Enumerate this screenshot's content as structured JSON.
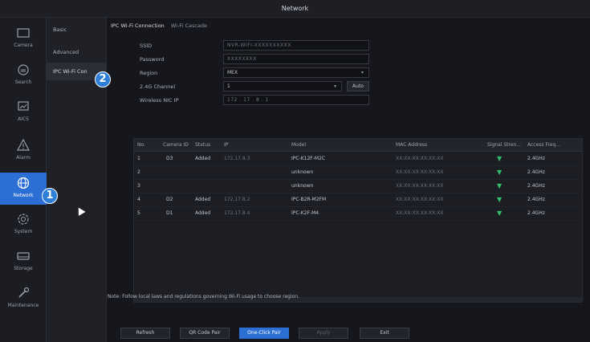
{
  "window": {
    "title": "Network"
  },
  "nav": {
    "items": [
      {
        "id": "camera",
        "label": "Camera",
        "icon": "camera-icon"
      },
      {
        "id": "search",
        "label": "Search",
        "icon": "search-icon"
      },
      {
        "id": "aics",
        "label": "AICS",
        "icon": "ai-icon"
      },
      {
        "id": "alarm",
        "label": "Alarm",
        "icon": "alarm-icon"
      },
      {
        "id": "network",
        "label": "Network",
        "icon": "globe-icon"
      },
      {
        "id": "system",
        "label": "System",
        "icon": "gear-icon"
      },
      {
        "id": "storage",
        "label": "Storage",
        "icon": "storage-icon"
      },
      {
        "id": "maintenance",
        "label": "Maintenance",
        "icon": "wrench-icon"
      }
    ]
  },
  "subnav": {
    "items": [
      {
        "label": "Basic"
      },
      {
        "label": "Advanced"
      },
      {
        "label": "IPC Wi-Fi Con"
      }
    ]
  },
  "tabs": [
    {
      "label": "IPC Wi-Fi Connection"
    },
    {
      "label": "Wi-Fi Cascade"
    }
  ],
  "form": {
    "ssid": {
      "label": "SSID",
      "value": "NVR-WIFI-XXXXXXXXXX"
    },
    "password": {
      "label": "Password",
      "value": "XXXXXXXX"
    },
    "region": {
      "label": "Region",
      "value": "MEX"
    },
    "channel": {
      "label": "2.4G Channel",
      "value": "1",
      "auto_label": "Auto"
    },
    "wireless_ip": {
      "label": "Wireless NIC IP",
      "value": "172 . 17 . 8 . 1"
    }
  },
  "table": {
    "headers": [
      "No.",
      "Camera ID",
      "Status",
      "IP",
      "Model",
      "MAC Address",
      "Signal Stren...",
      "Access Freq..."
    ],
    "rows": [
      {
        "no": "1",
        "camera_id": "D3",
        "status": "Added",
        "ip": "172.17.8.3",
        "model": "IPC-K12F-M2C",
        "mac": "XX:XX:XX:XX:XX:XX",
        "freq": "2.4GHz"
      },
      {
        "no": "2",
        "camera_id": "",
        "status": "",
        "ip": "",
        "model": "unknown",
        "mac": "XX:XX:XX:XX:XX:XX",
        "freq": "2.4GHz"
      },
      {
        "no": "3",
        "camera_id": "",
        "status": "",
        "ip": "",
        "model": "unknown",
        "mac": "XX:XX:XX:XX:XX:XX",
        "freq": "2.4GHz"
      },
      {
        "no": "4",
        "camera_id": "D2",
        "status": "Added",
        "ip": "172.17.8.2",
        "model": "IPC-B2R-M2FM",
        "mac": "XX:XX:XX:XX:XX:XX",
        "freq": "2.4GHz"
      },
      {
        "no": "5",
        "camera_id": "D1",
        "status": "Added",
        "ip": "172.17.8.4",
        "model": "IPC-K2F-M4",
        "mac": "XX:XX:XX:XX:XX:XX",
        "freq": "2.4GHz"
      }
    ]
  },
  "note": "Note: Follow local laws and regulations governing Wi-Fi usage to choose region.",
  "buttons": {
    "refresh": "Refresh",
    "qr_code_pair": "QR Code Pair",
    "one_click_pair": "One-Click Pair",
    "apply": "Apply",
    "exit": "Exit"
  },
  "annotations": {
    "badge1": "1",
    "badge2": "2"
  },
  "colors": {
    "accent": "#2c6fd4",
    "badge": "#2f7fd9",
    "signal": "#33c06a"
  }
}
